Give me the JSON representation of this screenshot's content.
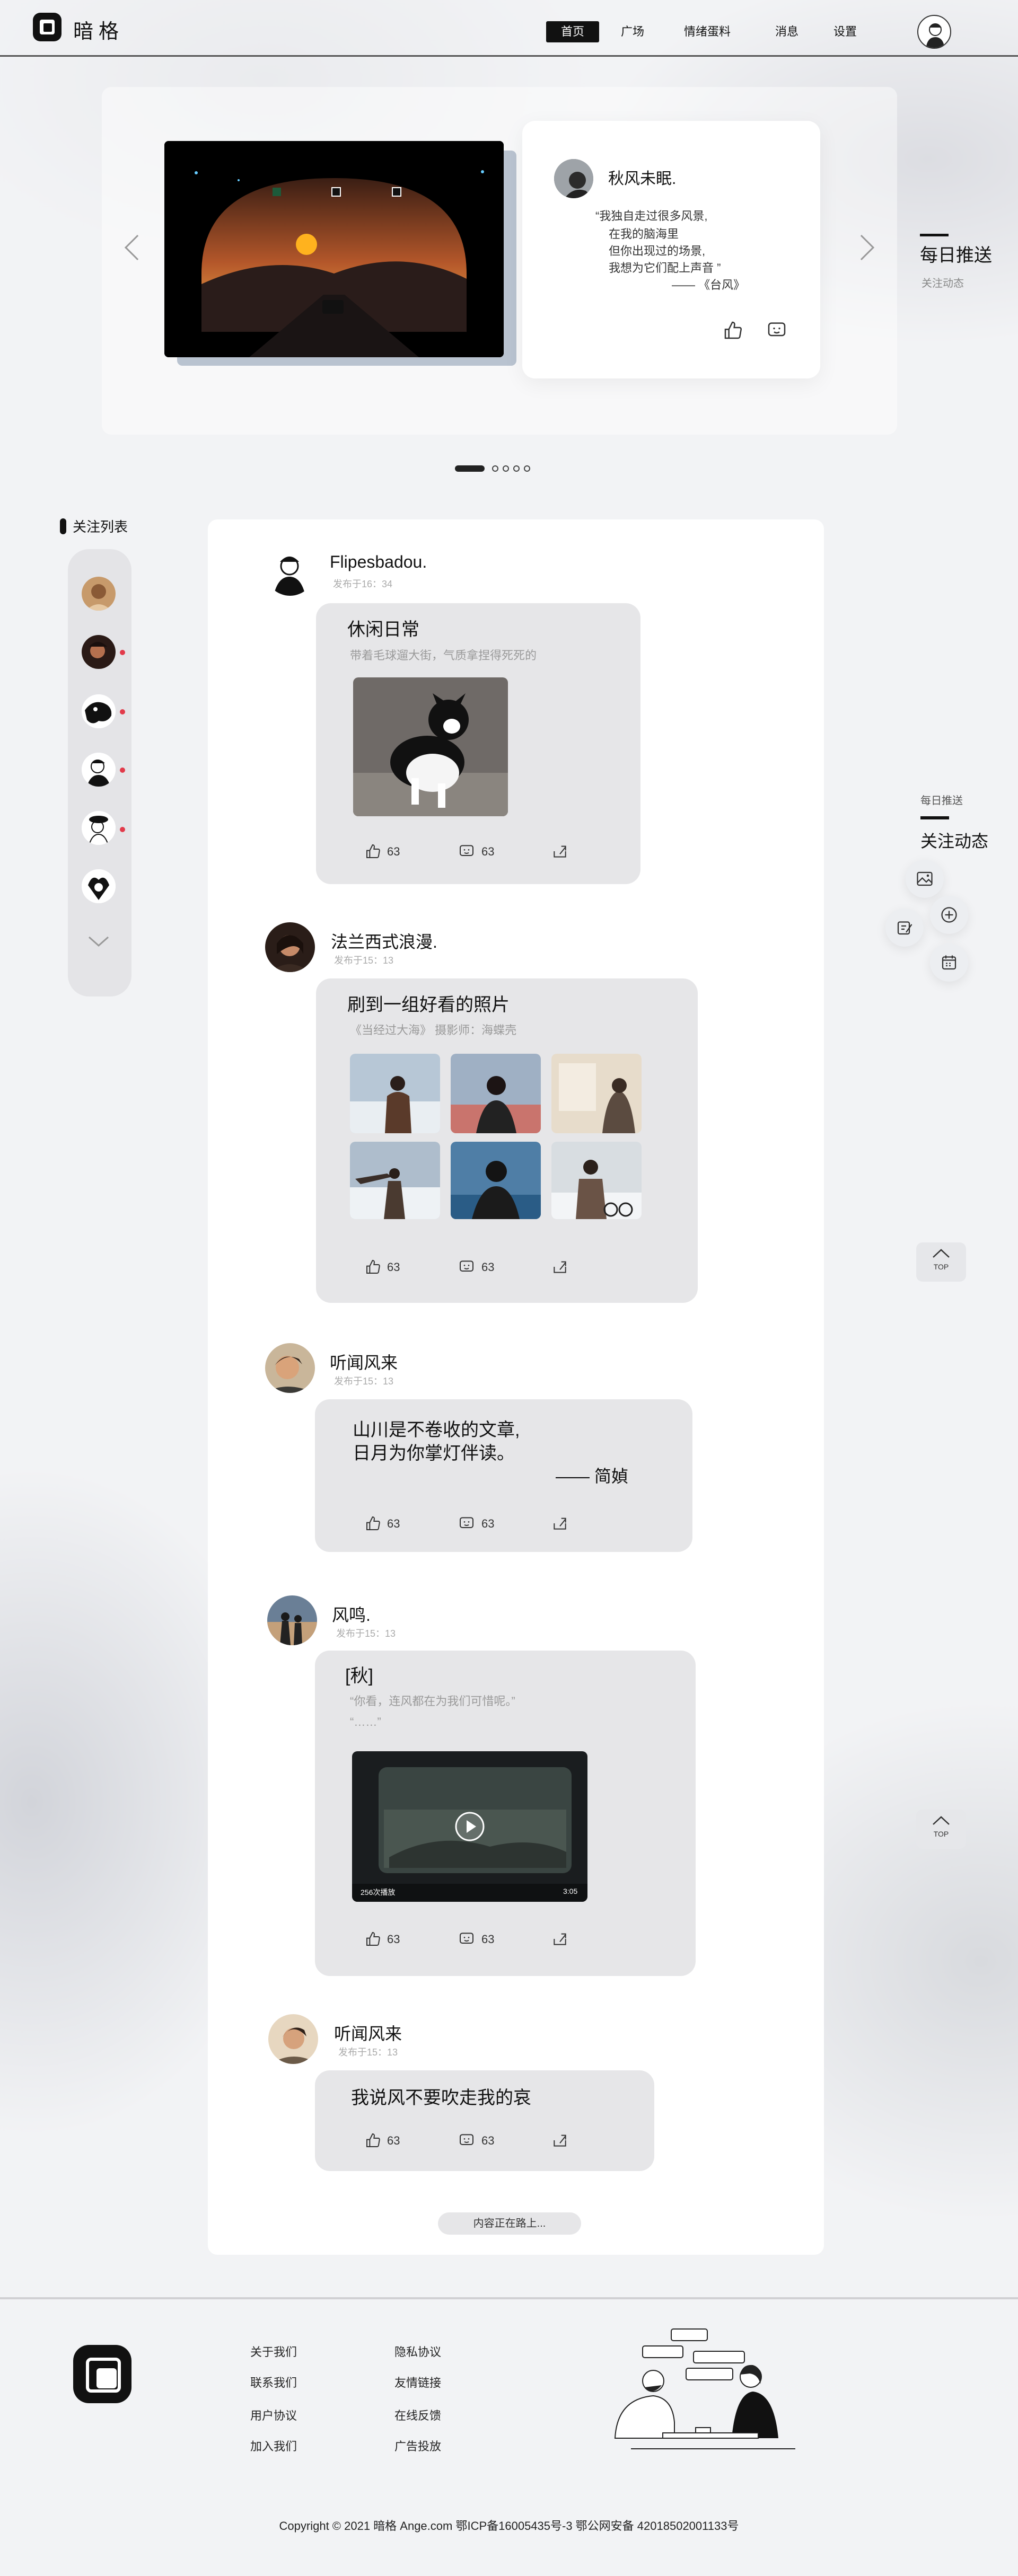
{
  "header": {
    "logo_text": "暗格",
    "nav": [
      "首页",
      "广场",
      "情绪蛋料",
      "消息",
      "设置"
    ]
  },
  "banner": {
    "author": "秋风未眠.",
    "quote_lines": [
      "“我独自走过很多风景,",
      "在我的脑海里",
      "但你出现过的场景,",
      "我想为它们配上声音 ”",
      "—— 《台风》"
    ],
    "side_title": "每日推送",
    "side_sub": "关注动态",
    "dots_total": 5,
    "dots_active": 1
  },
  "follow": {
    "title": "关注列表"
  },
  "posts": [
    {
      "author": "Flipesbadou.",
      "time": "发布于16：34",
      "title": "休闲日常",
      "sub": "带着毛球遛大街，气质拿捏得死死的",
      "likes": "63",
      "comments": "63"
    },
    {
      "author": "法兰西式浪漫.",
      "time": "发布于15：13",
      "title": "刷到一组好看的照片",
      "sub": "《当经过大海》   摄影师：海蝶壳",
      "likes": "63",
      "comments": "63"
    },
    {
      "author": "听闻风来",
      "time": "发布于15：13",
      "line1": "山川是不卷收的文章,",
      "line2": "日月为你掌灯伴读。",
      "sign": "—— 简媜",
      "likes": "63",
      "comments": "63"
    },
    {
      "author": "风鸣.",
      "time": "发布于15：13",
      "title": "[秋]",
      "sub1": "“你看，连风都在为我们可惜呢。”",
      "sub2": "“……”",
      "video_views": "256次播放",
      "video_duration": "3:05",
      "likes": "63",
      "comments": "63"
    },
    {
      "author": "听闻风来",
      "time": "发布于15：13",
      "title": "我说风不要吹走我的哀",
      "likes": "63",
      "comments": "63"
    }
  ],
  "loading": "内容正在路上...",
  "right": {
    "small": "每日推送",
    "big": "关注动态",
    "top_label": "TOP"
  },
  "footer": {
    "links_col1": [
      "关于我们",
      "联系我们",
      "用户协议",
      "加入我们"
    ],
    "links_col2": [
      "隐私协议",
      "友情链接",
      "在线反馈",
      "广告投放"
    ],
    "copyright": "Copyright © 2021 暗格 Ange.com 鄂ICP备16005435号-3 鄂公网安备 42018502001133号"
  }
}
